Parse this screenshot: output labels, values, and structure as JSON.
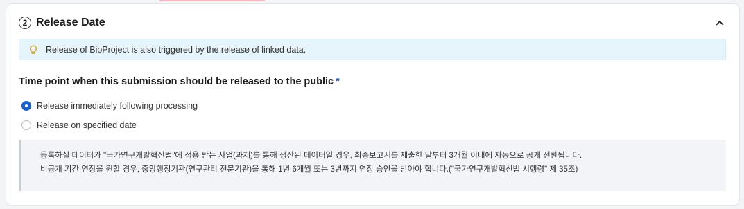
{
  "section": {
    "step_number": "2",
    "title": "Release Date"
  },
  "info_banner": {
    "icon": "lightbulb-icon",
    "icon_color": "#e0a020",
    "text": "Release of BioProject is also triggered by the release of linked data."
  },
  "question": {
    "label": "Time point when this submission should be released to the public",
    "required_mark": "*"
  },
  "options": [
    {
      "label": "Release immediately following processing",
      "selected": true
    },
    {
      "label": "Release on specified date",
      "selected": false
    }
  ],
  "note": {
    "lines": [
      "등록하실 데이터가 \"국가연구개발혁신법\"에 적용 받는 사업(과제)를 통해 생산된 데이터일 경우, 최종보고서를 제출한 날부터 3개월 이내에 자동으로 공개 전환됩니다.",
      "비공개 기간 연장을 원할 경우, 중앙행정기관(연구관리 전문기관)을 통해 1년 6개월 또는 3년까지 연장 승인을 받아야 합니다.(\"국가연구개발혁신법 시행령\" 제 35조)"
    ]
  },
  "colors": {
    "accent": "#1a5fd0",
    "banner_bg": "#e6f4fb",
    "note_bg": "#f3f4f7"
  }
}
